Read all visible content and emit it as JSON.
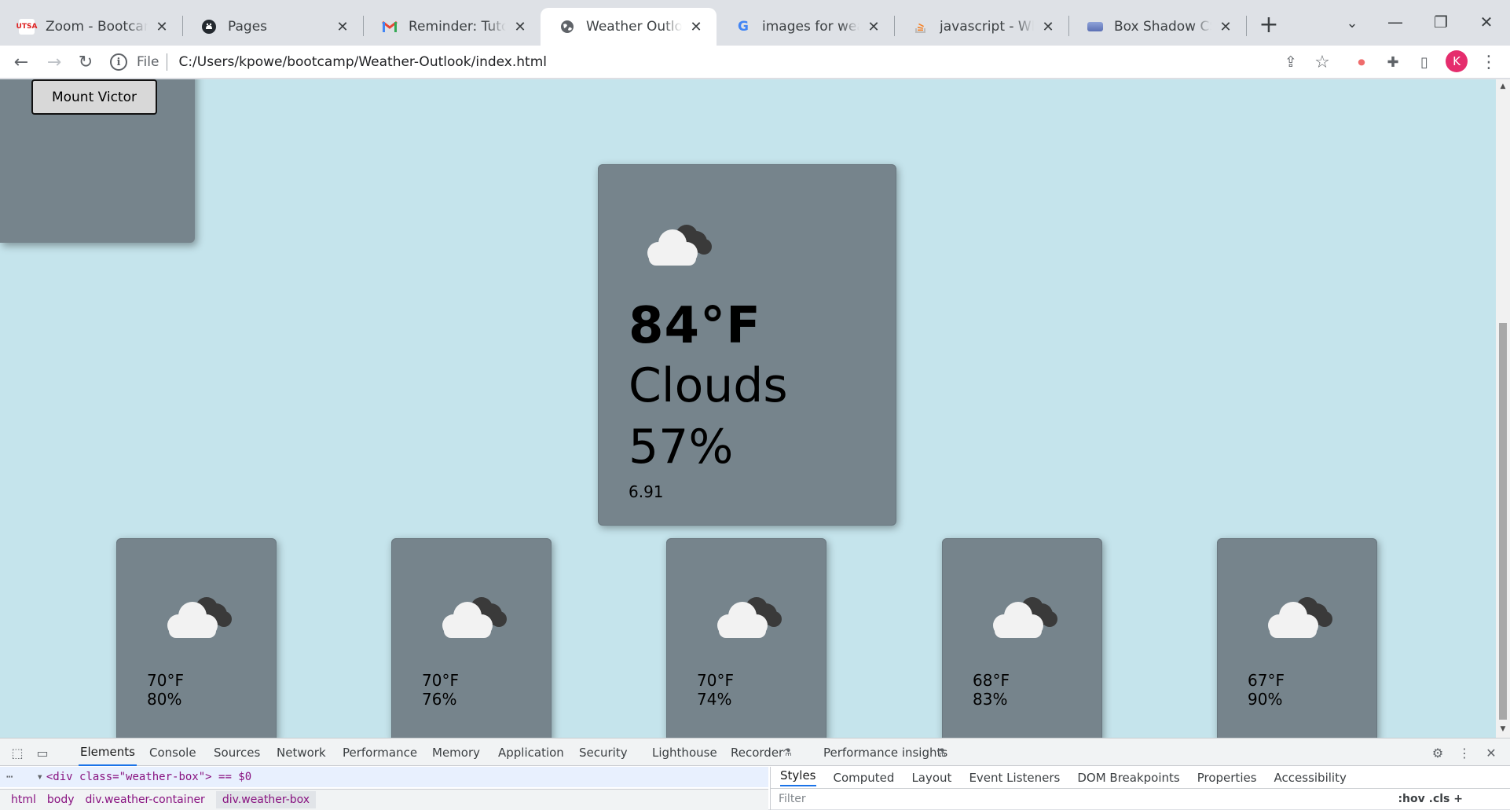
{
  "browser": {
    "tabs": [
      {
        "title": "Zoom - Bootcamp: UT",
        "icon": "zoom-favicon",
        "active": false
      },
      {
        "title": "Pages",
        "icon": "github-favicon",
        "active": false
      },
      {
        "title": "Reminder: Tutor Sessi",
        "icon": "gmail-favicon",
        "active": false
      },
      {
        "title": "Weather Outlook",
        "icon": "globe-favicon",
        "active": true
      },
      {
        "title": "images for weather ou",
        "icon": "google-favicon",
        "active": false
      },
      {
        "title": "javascript - Why did I",
        "icon": "stackoverflow-favicon",
        "active": false
      },
      {
        "title": "Box Shadow CSS Gen",
        "icon": "generic-favicon",
        "active": false
      }
    ],
    "new_tab_label": "+",
    "address": {
      "scheme": "File",
      "url": "C:/Users/kpowe/bootcamp/Weather-Outlook/index.html"
    },
    "profile_initial": "K"
  },
  "page": {
    "city_button": "Mount Victor",
    "current": {
      "icon": "clouds-icon",
      "temperature": "84°F",
      "condition": "Clouds",
      "humidity": "57%",
      "wind": "6.91"
    },
    "forecast": [
      {
        "icon": "clouds-icon",
        "temperature": "70°F",
        "humidity": "80%"
      },
      {
        "icon": "clouds-icon",
        "temperature": "70°F",
        "humidity": "76%"
      },
      {
        "icon": "clouds-icon",
        "temperature": "70°F",
        "humidity": "74%"
      },
      {
        "icon": "clouds-icon",
        "temperature": "68°F",
        "humidity": "83%"
      },
      {
        "icon": "clouds-icon",
        "temperature": "67°F",
        "humidity": "90%"
      }
    ]
  },
  "devtools": {
    "tabs": [
      "Elements",
      "Console",
      "Sources",
      "Network",
      "Performance",
      "Memory",
      "Application",
      "Security",
      "Lighthouse",
      "Recorder",
      "Performance insights"
    ],
    "selected_node": "<div class=\"weather-box\"> == $0",
    "breadcrumbs": [
      "html",
      "body",
      "div.weather-container",
      "div.weather-box"
    ],
    "side_tabs": [
      "Styles",
      "Computed",
      "Layout",
      "Event Listeners",
      "DOM Breakpoints",
      "Properties",
      "Accessibility"
    ],
    "filter_placeholder": "Filter",
    "filter_tools": ":hov .cls +"
  },
  "colors": {
    "page_bg": "#c5e4ec",
    "card_bg": "#76848c",
    "tab_strip": "#dee1e6",
    "accent": "#1a73e8"
  }
}
